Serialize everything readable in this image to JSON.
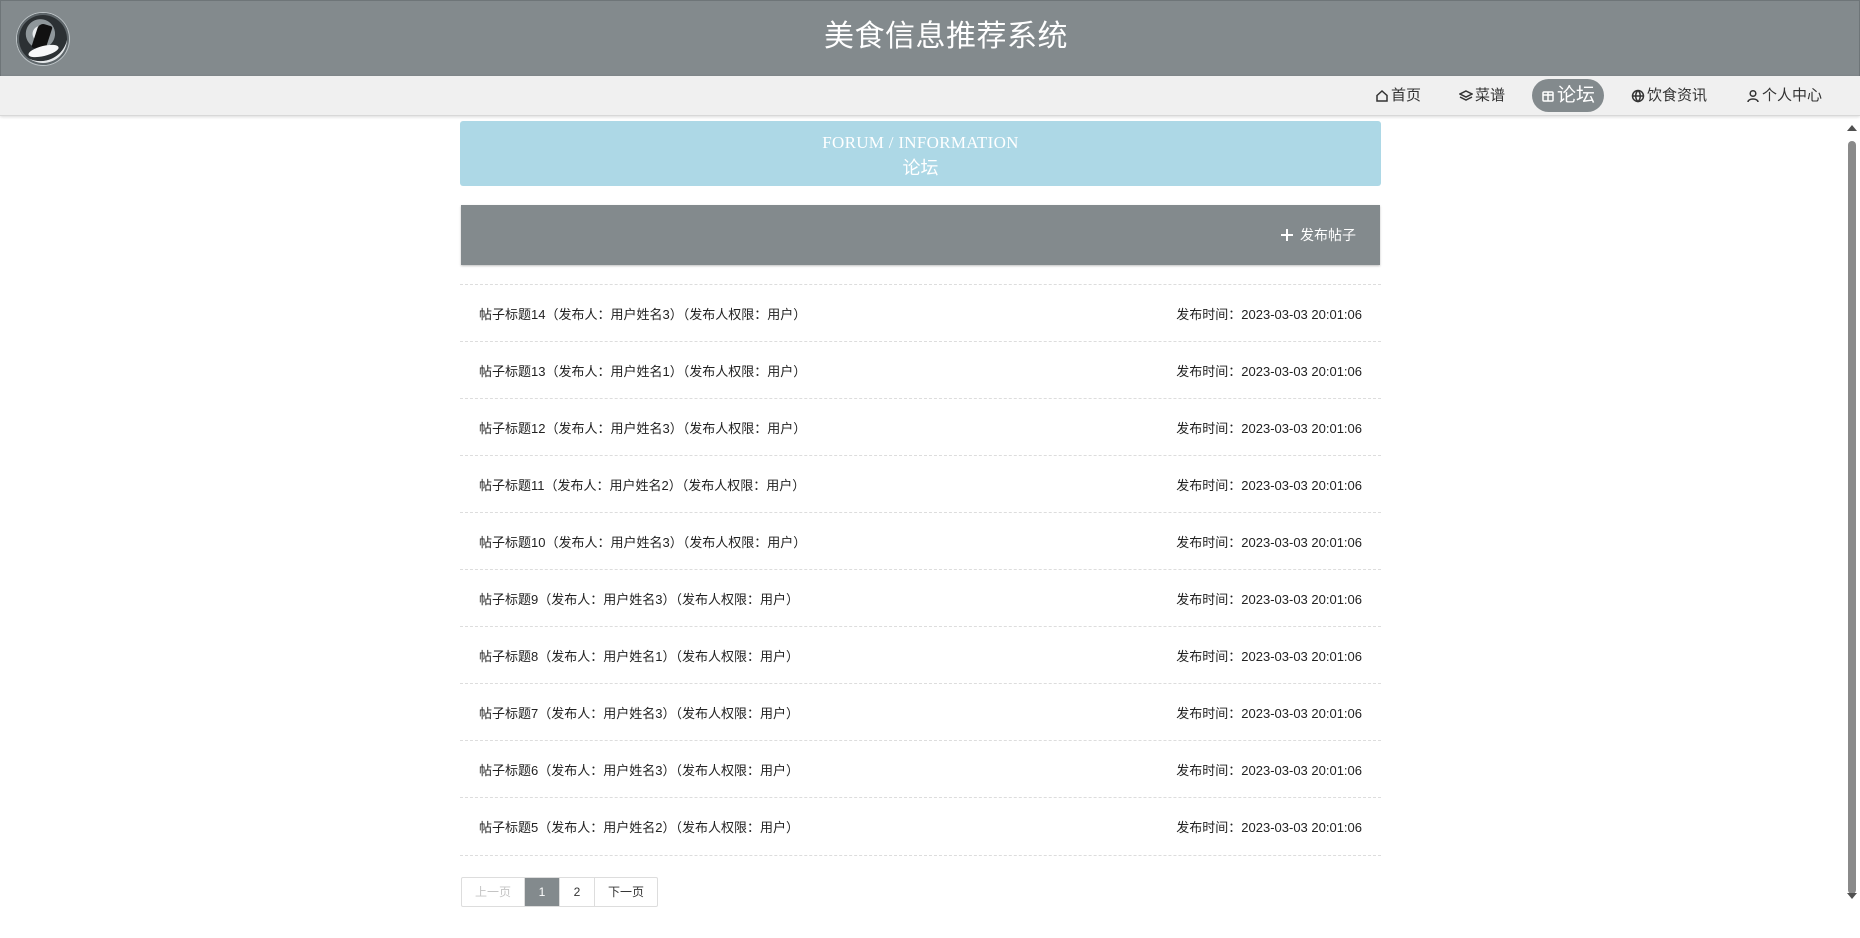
{
  "app": {
    "title": "美食信息推荐系统"
  },
  "nav": {
    "items": [
      {
        "label": "首页",
        "icon": "home-icon"
      },
      {
        "label": "菜谱",
        "icon": "layers-icon"
      },
      {
        "label": "论坛",
        "icon": "forum-icon",
        "active": true
      },
      {
        "label": "饮食资讯",
        "icon": "globe-icon"
      },
      {
        "label": "个人中心",
        "icon": "user-icon"
      }
    ]
  },
  "banner": {
    "title_en": "FORUM / INFORMATION",
    "title_cn": "论坛"
  },
  "toolbar": {
    "post_label": "发布帖子"
  },
  "posts": [
    {
      "title": "帖子标题14（发布人：用户姓名3）（发布人权限：用户）",
      "time": "发布时间：2023-03-03 20:01:06"
    },
    {
      "title": "帖子标题13（发布人：用户姓名1）（发布人权限：用户）",
      "time": "发布时间：2023-03-03 20:01:06"
    },
    {
      "title": "帖子标题12（发布人：用户姓名3）（发布人权限：用户）",
      "time": "发布时间：2023-03-03 20:01:06"
    },
    {
      "title": "帖子标题11（发布人：用户姓名2）（发布人权限：用户）",
      "time": "发布时间：2023-03-03 20:01:06"
    },
    {
      "title": "帖子标题10（发布人：用户姓名3）（发布人权限：用户）",
      "time": "发布时间：2023-03-03 20:01:06"
    },
    {
      "title": "帖子标题9（发布人：用户姓名3）（发布人权限：用户）",
      "time": "发布时间：2023-03-03 20:01:06"
    },
    {
      "title": "帖子标题8（发布人：用户姓名1）（发布人权限：用户）",
      "time": "发布时间：2023-03-03 20:01:06"
    },
    {
      "title": "帖子标题7（发布人：用户姓名3）（发布人权限：用户）",
      "time": "发布时间：2023-03-03 20:01:06"
    },
    {
      "title": "帖子标题6（发布人：用户姓名3）（发布人权限：用户）",
      "time": "发布时间：2023-03-03 20:01:06"
    },
    {
      "title": "帖子标题5（发布人：用户姓名2）（发布人权限：用户）",
      "time": "发布时间：2023-03-03 20:01:06"
    }
  ],
  "pagination": {
    "prev": "上一页",
    "pages": [
      "1",
      "2"
    ],
    "current": "1",
    "next": "下一页"
  },
  "colors": {
    "header": "#838a8d",
    "banner": "#add8e6",
    "nav_bg": "#f0f0f0"
  }
}
